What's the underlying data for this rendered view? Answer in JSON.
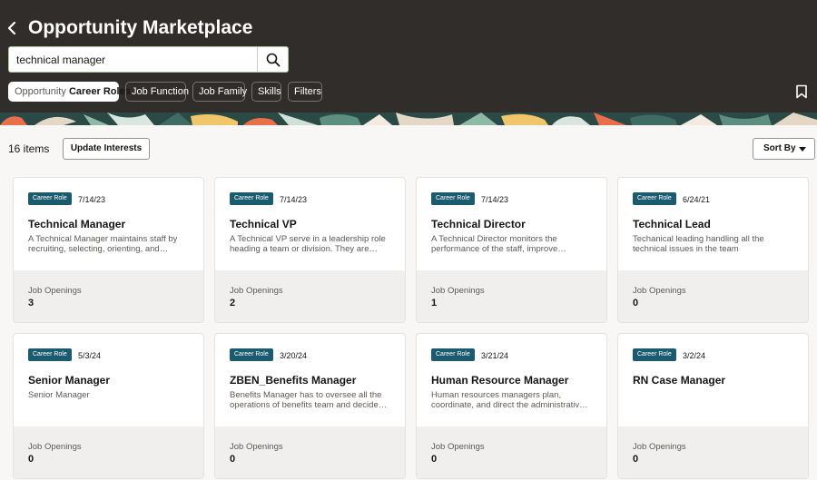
{
  "header": {
    "title": "Opportunity Marketplace",
    "search": {
      "value": "technical manager",
      "placeholder": ""
    },
    "chips": [
      {
        "prefix": "Opportunity",
        "value": "Career Roles"
      },
      {
        "label": "Job Function"
      },
      {
        "label": "Job Family"
      },
      {
        "label": "Skills"
      },
      {
        "label": "Filters"
      }
    ]
  },
  "toolbar": {
    "count": "16 items",
    "update_label": "Update Interests",
    "sort_label": "Sort By"
  },
  "cards": [
    {
      "badge": "Career Role",
      "date": "7/14/23",
      "title": "Technical Manager",
      "desc": "A Technical Manager maintains staff by recruiting, selecting, orienting, and…",
      "openings_label": "Job Openings",
      "openings": "3"
    },
    {
      "badge": "Career Role",
      "date": "7/14/23",
      "title": "Technical VP",
      "desc": "A Technical VP serve in a leadership role heading a team or division. They are…",
      "openings_label": "Job Openings",
      "openings": "2"
    },
    {
      "badge": "Career Role",
      "date": "7/14/23",
      "title": "Technical Director",
      "desc": "A Technical Director monitors the performance of the staff, improve…",
      "openings_label": "Job Openings",
      "openings": "1"
    },
    {
      "badge": "Career Role",
      "date": "6/24/21",
      "title": "Technical Lead",
      "desc": "Techanical leading handling all the technical issues in the team",
      "openings_label": "Job Openings",
      "openings": "0"
    },
    {
      "badge": "Career Role",
      "date": "5/3/24",
      "title": "Senior Manager",
      "desc": "Senior Manager",
      "openings_label": "Job Openings",
      "openings": "0"
    },
    {
      "badge": "Career Role",
      "date": "3/20/24",
      "title": "ZBEN_Benefits Manager",
      "desc": "Benefits Manager has to oversee all the operations of benefits team and decide…",
      "openings_label": "Job Openings",
      "openings": "0"
    },
    {
      "badge": "Career Role",
      "date": "3/21/24",
      "title": "Human Resource Manager",
      "desc": "Human resources managers plan, coordinate, and direct the administrativ…",
      "openings_label": "Job Openings",
      "openings": "0"
    },
    {
      "badge": "Career Role",
      "date": "3/2/24",
      "title": "RN Case Manager",
      "desc": "",
      "openings_label": "Job Openings",
      "openings": "0"
    }
  ],
  "colors": {
    "header_bg": "#312d2a",
    "badge_bg": "#1b5b70",
    "page_bg": "#f8f7f5"
  },
  "icons": {
    "back": "chevron-left-icon",
    "search": "search-icon",
    "bookmark": "bookmark-icon",
    "sort": "caret-down-icon"
  }
}
